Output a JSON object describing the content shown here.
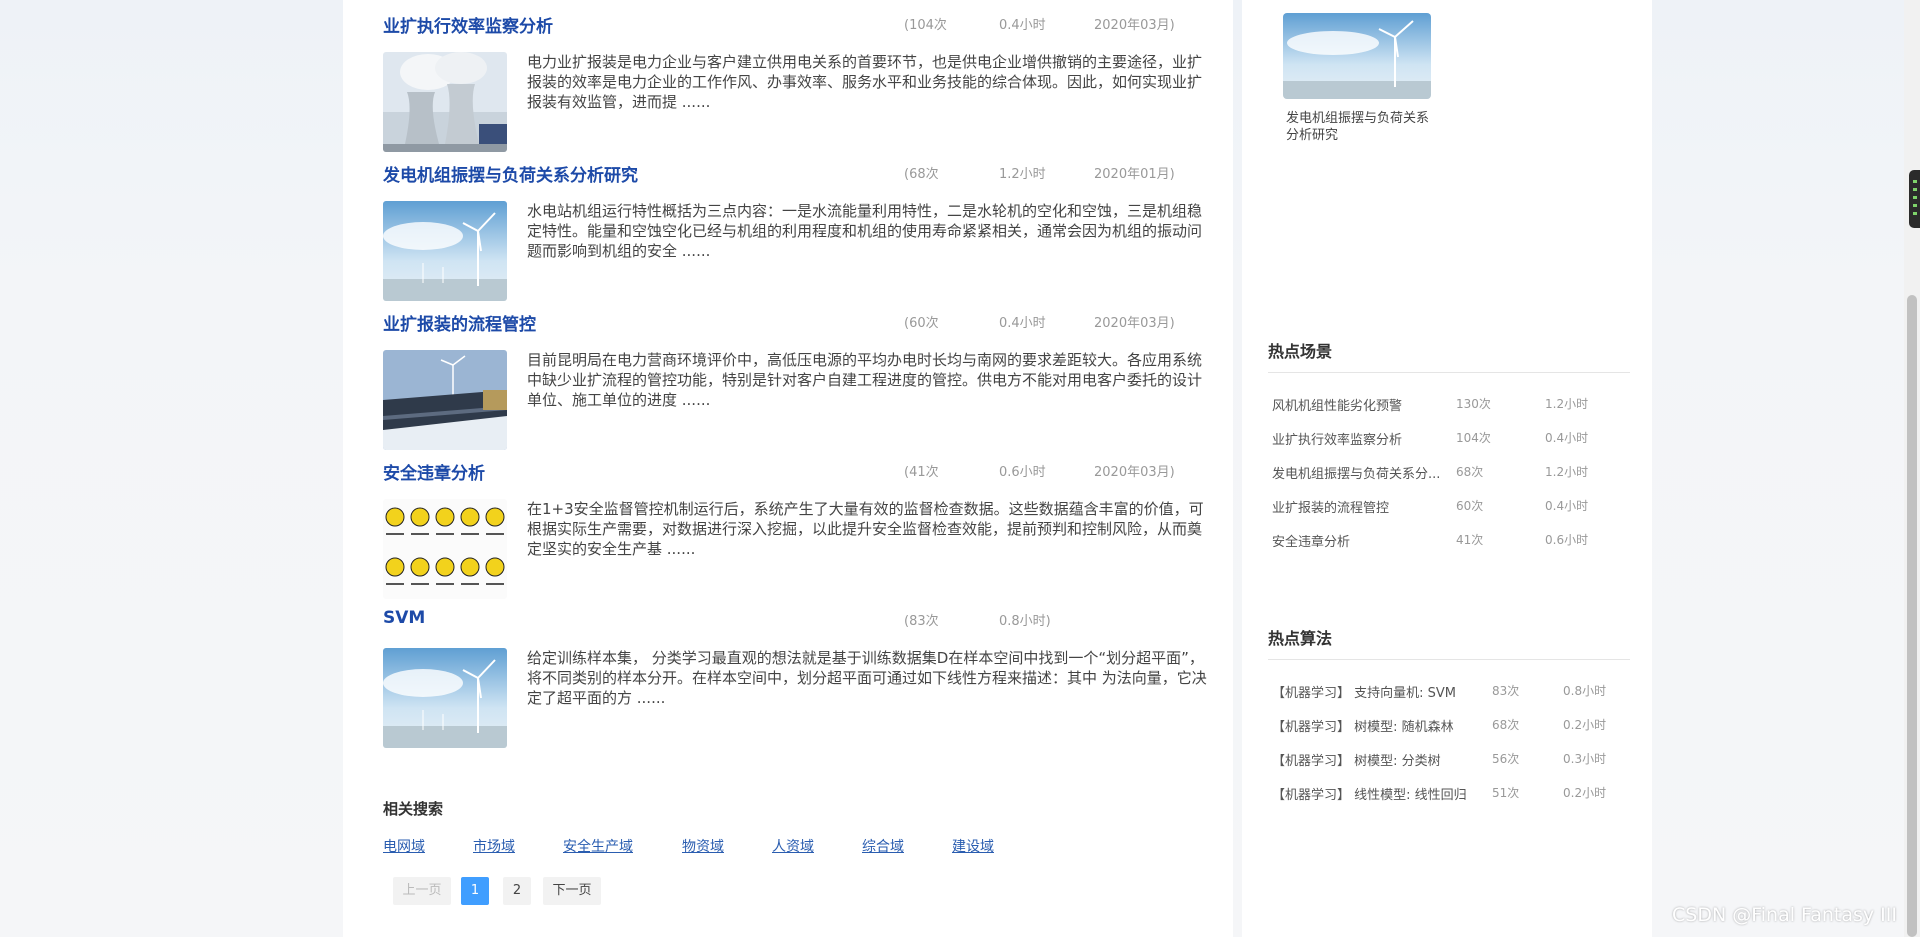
{
  "articles": [
    {
      "title": "业扩执行效率监察分析",
      "views": "(104次",
      "duration": "0.4小时",
      "date": "2020年03月)",
      "summary": "电力业扩报装是电力企业与客户建立供用电关系的首要环节，也是供电企业增供撤销的主要途径，业扩报装的效率是电力企业的工作作风、办事效率、服务水平和业务技能的综合体现。因此，如何实现业扩报装有效监管，进而提 ......",
      "thumb": "cooling-tower-image"
    },
    {
      "title": "发电机组振摆与负荷关系分析研究",
      "views": "(68次",
      "duration": "1.2小时",
      "date": "2020年01月)",
      "summary": "水电站机组运行特性概括为三点内容：一是水流能量利用特性，二是水轮机的空化和空蚀，三是机组稳定特性。能量和空蚀空化已经与机组的利用程度和机组的使用寿命紧紧相关，通常会因为机组的振动问题而影响到机组的安全 ......",
      "thumb": "wind-turbine-image"
    },
    {
      "title": "业扩报装的流程管控",
      "views": "(60次",
      "duration": "0.4小时",
      "date": "2020年03月)",
      "summary": "目前昆明局在电力营商环境评价中，高低压电源的平均办电时长均与南网的要求差距较大。各应用系统中缺少业扩流程的管控功能，特别是针对客户自建工程进度的管控。供电方不能对用电客户委托的设计单位、施工单位的进度 ......",
      "thumb": "solar-panel-image"
    },
    {
      "title": "安全违章分析",
      "views": "(41次",
      "duration": "0.6小时",
      "date": "2020年03月)",
      "summary": "在1+3安全监督管控机制运行后，系统产生了大量有效的监督检查数据。这些数据蕴含丰富的价值，可根据实际生产需要，对数据进行深入挖掘，以此提升安全监督检查效能，提前预判和控制风险，从而奠定坚实的安全生产基 ......",
      "thumb": "safety-signs-image"
    },
    {
      "title": "SVM",
      "views": "(83次",
      "duration": "0.8小时)",
      "date": "",
      "summary": "给定训练样本集， 分类学习最直观的想法就是基于训练数据集D在样本空间中找到一个“划分超平面”，将不同类别的样本分开。在样本空间中，划分超平面可通过如下线性方程来描述：其中 为法向量，它决定了超平面的方 ......",
      "thumb": "wind-turbine-image"
    }
  ],
  "related": {
    "title": "相关搜索",
    "links": [
      "电网域",
      "市场域",
      "安全生产域",
      "物资域",
      "人资域",
      "综合域",
      "建设域"
    ]
  },
  "pagination": {
    "prev": "上一页",
    "pages": [
      "1",
      "2"
    ],
    "current": "1",
    "next": "下一页"
  },
  "sidebar": {
    "featured_caption": "发电机组振摆与负荷关系分析研究",
    "hot_scenes": {
      "title": "热点场景",
      "rows": [
        {
          "name": "风机机组性能劣化预警",
          "count": "130次",
          "hours": "1.2小时"
        },
        {
          "name": "业扩执行效率监察分析",
          "count": "104次",
          "hours": "0.4小时"
        },
        {
          "name": "发电机组振摆与负荷关系分...",
          "count": "68次",
          "hours": "1.2小时"
        },
        {
          "name": "业扩报装的流程管控",
          "count": "60次",
          "hours": "0.4小时"
        },
        {
          "name": "安全违章分析",
          "count": "41次",
          "hours": "0.6小时"
        }
      ]
    },
    "hot_algorithms": {
      "title": "热点算法",
      "rows": [
        {
          "name": "【机器学习】 支持向量机: SVM",
          "count": "83次",
          "hours": "0.8小时"
        },
        {
          "name": "【机器学习】 树模型: 随机森林",
          "count": "68次",
          "hours": "0.2小时"
        },
        {
          "name": "【机器学习】 树模型: 分类树",
          "count": "56次",
          "hours": "0.3小时"
        },
        {
          "name": "【机器学习】 线性模型: 线性回归",
          "count": "51次",
          "hours": "0.2小时"
        }
      ]
    }
  },
  "watermark": "CSDN @Final Fantasy III",
  "colors": {
    "title_blue": "#1d4aa8",
    "link_blue": "#2a5db0",
    "active_page": "#409eff"
  }
}
